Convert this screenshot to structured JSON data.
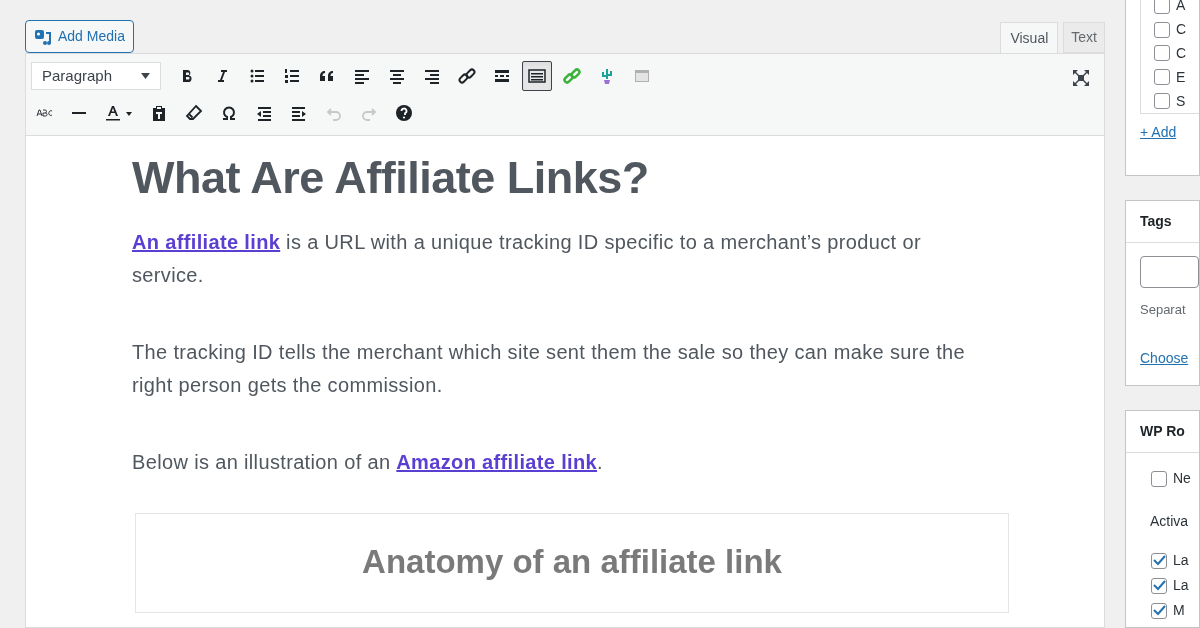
{
  "add_media": {
    "label": "Add Media"
  },
  "editor_tabs": [
    {
      "label": "Visual",
      "selected": true
    },
    {
      "label": "Text",
      "selected": false
    }
  ],
  "format_select": {
    "value": "Paragraph"
  },
  "toolbar_row_1": [
    {
      "kind": "bold",
      "active": false,
      "disabled": false
    },
    {
      "kind": "italic",
      "active": false,
      "disabled": false
    },
    {
      "kind": "bullets",
      "active": false,
      "disabled": false
    },
    {
      "kind": "numbers",
      "active": false,
      "disabled": false
    },
    {
      "kind": "quote",
      "active": false,
      "disabled": false
    },
    {
      "kind": "align-left",
      "active": false,
      "disabled": false
    },
    {
      "kind": "align-center",
      "active": false,
      "disabled": false
    },
    {
      "kind": "align-right",
      "active": false,
      "disabled": false
    },
    {
      "kind": "link",
      "active": false,
      "disabled": false
    },
    {
      "kind": "more",
      "active": false,
      "disabled": false
    },
    {
      "kind": "toolbar-toggle",
      "active": true,
      "disabled": false
    },
    {
      "kind": "green-link",
      "active": false,
      "disabled": false
    },
    {
      "kind": "cactus",
      "active": false,
      "disabled": false
    },
    {
      "kind": "table",
      "active": false,
      "disabled": false
    }
  ],
  "toolbar_row_2": [
    {
      "kind": "strike",
      "active": false,
      "disabled": false
    },
    {
      "kind": "hr",
      "active": false,
      "disabled": false
    },
    {
      "kind": "text-color",
      "active": false,
      "disabled": false
    },
    {
      "kind": "paste",
      "active": false,
      "disabled": false
    },
    {
      "kind": "eraser",
      "active": false,
      "disabled": false
    },
    {
      "kind": "omega",
      "active": false,
      "disabled": false
    },
    {
      "kind": "outdent",
      "active": false,
      "disabled": false
    },
    {
      "kind": "indent",
      "active": false,
      "disabled": false
    },
    {
      "kind": "undo",
      "active": false,
      "disabled": true
    },
    {
      "kind": "redo",
      "active": false,
      "disabled": true
    },
    {
      "kind": "help",
      "active": false,
      "disabled": false
    }
  ],
  "content": {
    "heading": "What Are Affiliate Links?",
    "paragraphs": [
      [
        {
          "text": "An affiliate link",
          "link": true
        },
        {
          "text": " is a URL with a unique tracking ID specific to a merchant’s product or service.",
          "link": false
        }
      ],
      [
        {
          "text": "The tracking ID tells the merchant which site sent them the sale so they can make sure the right person gets the commission.",
          "link": false
        }
      ],
      [
        {
          "text": "Below is an illustration of an ",
          "link": false
        },
        {
          "text": "Amazon affiliate link",
          "link": true
        },
        {
          "text": ".",
          "link": false
        }
      ]
    ],
    "figure_title": "Anatomy of an affiliate link"
  },
  "sidebar": {
    "categories": [
      {
        "label": "A",
        "checked": false
      },
      {
        "label": "C",
        "checked": false
      },
      {
        "label": "C",
        "checked": false
      },
      {
        "label": "E",
        "checked": false
      },
      {
        "label": "S",
        "checked": false
      }
    ],
    "add_link": "+ Add",
    "tags": {
      "title": "Tags",
      "hint": "Separat",
      "choose_link": "Choose"
    },
    "wp_panel": {
      "title": "WP Ro",
      "option": {
        "label": "Ne",
        "checked": false
      },
      "section_label": "Activa",
      "items": [
        {
          "label": "La",
          "checked": true
        },
        {
          "label": "La",
          "checked": true
        },
        {
          "label": "M",
          "checked": true
        }
      ]
    }
  }
}
